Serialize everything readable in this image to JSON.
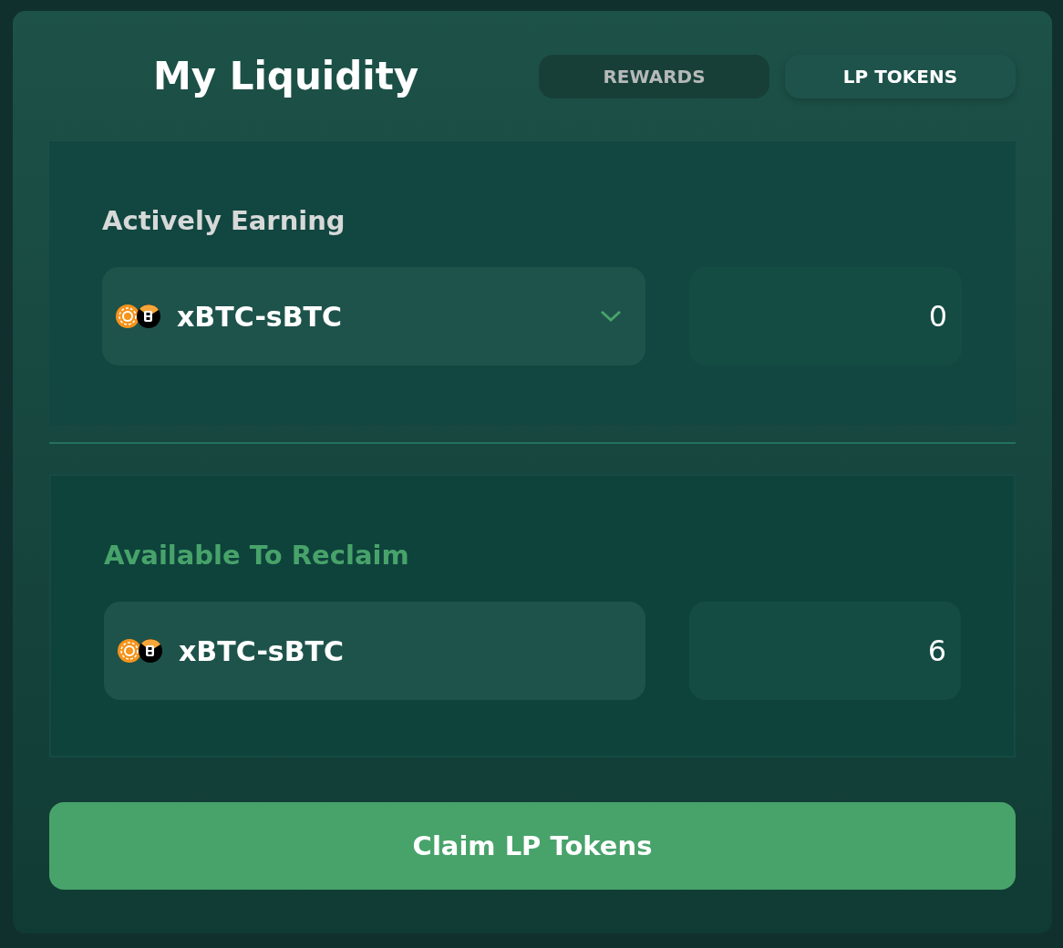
{
  "title": "My Liquidity",
  "tabs": [
    {
      "label": "REWARDS",
      "selected": false
    },
    {
      "label": "LP TOKENS",
      "selected": true
    }
  ],
  "sections": [
    {
      "heading": "Actively Earning",
      "color": "#d6d9d8",
      "kind": "select",
      "token": "xBTC-sBTC",
      "amount": "0"
    },
    {
      "heading": "Available To Reclaim",
      "color": "#48a36a",
      "kind": "static",
      "token": "xBTC-sBTC",
      "amount": "6"
    }
  ],
  "button": "Claim LP Tokens"
}
